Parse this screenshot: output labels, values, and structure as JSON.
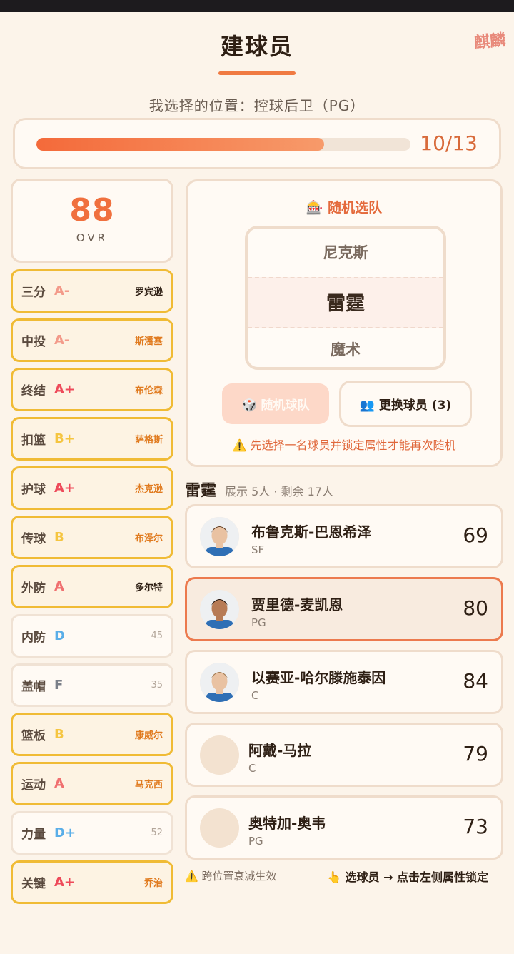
{
  "header": {
    "title": "建球员",
    "logo_text": "麒麟",
    "position_prompt": "我选择的位置：控球后卫（PG）"
  },
  "progress": {
    "current": 10,
    "total": 13,
    "label": "10/13"
  },
  "ovr": {
    "value": "88",
    "label": "OVR"
  },
  "attributes": [
    {
      "name": "三分",
      "grade": "A-",
      "grade_color": "#f39a8a",
      "locked": true,
      "right": "罗宾逊",
      "right_color": "#2e1f14"
    },
    {
      "name": "中投",
      "grade": "A-",
      "grade_color": "#f39a8a",
      "locked": true,
      "right": "斯潘塞",
      "right_color": "#e07a1e"
    },
    {
      "name": "终结",
      "grade": "A+",
      "grade_color": "#ee4a5a",
      "locked": true,
      "right": "布伦森",
      "right_color": "#e07a1e"
    },
    {
      "name": "扣篮",
      "grade": "B+",
      "grade_color": "#f5c540",
      "locked": true,
      "right": "萨格斯",
      "right_color": "#e07a1e"
    },
    {
      "name": "护球",
      "grade": "A+",
      "grade_color": "#ee4a5a",
      "locked": true,
      "right": "杰克逊",
      "right_color": "#e07a1e"
    },
    {
      "name": "传球",
      "grade": "B",
      "grade_color": "#f5c540",
      "locked": true,
      "right": "布泽尔",
      "right_color": "#e07a1e"
    },
    {
      "name": "外防",
      "grade": "A",
      "grade_color": "#f07070",
      "locked": true,
      "right": "多尔特",
      "right_color": "#2e1f14"
    },
    {
      "name": "内防",
      "grade": "D",
      "grade_color": "#5aaee8",
      "locked": false,
      "right": "45"
    },
    {
      "name": "盖帽",
      "grade": "F",
      "grade_color": "#7a7f88",
      "locked": false,
      "right": "35"
    },
    {
      "name": "篮板",
      "grade": "B",
      "grade_color": "#f5c540",
      "locked": true,
      "right": "康威尔",
      "right_color": "#e07a1e"
    },
    {
      "name": "运动",
      "grade": "A",
      "grade_color": "#f07070",
      "locked": true,
      "right": "马克西",
      "right_color": "#e07a1e"
    },
    {
      "name": "力量",
      "grade": "D+",
      "grade_color": "#5aaee8",
      "locked": false,
      "right": "52"
    },
    {
      "name": "关键",
      "grade": "A+",
      "grade_color": "#ee4a5a",
      "locked": true,
      "right": "乔治",
      "right_color": "#e07a1e"
    }
  ],
  "random": {
    "title": "🎰 随机选队",
    "slot_prev": "尼克斯",
    "slot_current": "雷霆",
    "slot_next": "魔术",
    "random_button": "🎲 随机球队",
    "swap_button": "👥 更换球员 (3)",
    "warning": "⚠️ 先选择一名球员并锁定属性才能再次随机"
  },
  "team": {
    "name": "雷霆",
    "meta": "展示 5人 · 剩余 17人"
  },
  "players": [
    {
      "name": "布鲁克斯-巴恩希泽",
      "pos": "SF",
      "rating": "69",
      "selected": false,
      "photo": true
    },
    {
      "name": "贾里德-麦凯恩",
      "pos": "PG",
      "rating": "80",
      "selected": true,
      "photo": true
    },
    {
      "name": "以赛亚-哈尔滕施泰因",
      "pos": "C",
      "rating": "84",
      "selected": false,
      "photo": true
    },
    {
      "name": "阿戴-马拉",
      "pos": "C",
      "rating": "79",
      "selected": false,
      "photo": false
    },
    {
      "name": "奥特加-奥韦",
      "pos": "PG",
      "rating": "73",
      "selected": false,
      "photo": false
    }
  ],
  "footer": {
    "left": "⚠️ 跨位置衰减生效",
    "right": "👆 选球员 → 点击左侧属性锁定"
  }
}
